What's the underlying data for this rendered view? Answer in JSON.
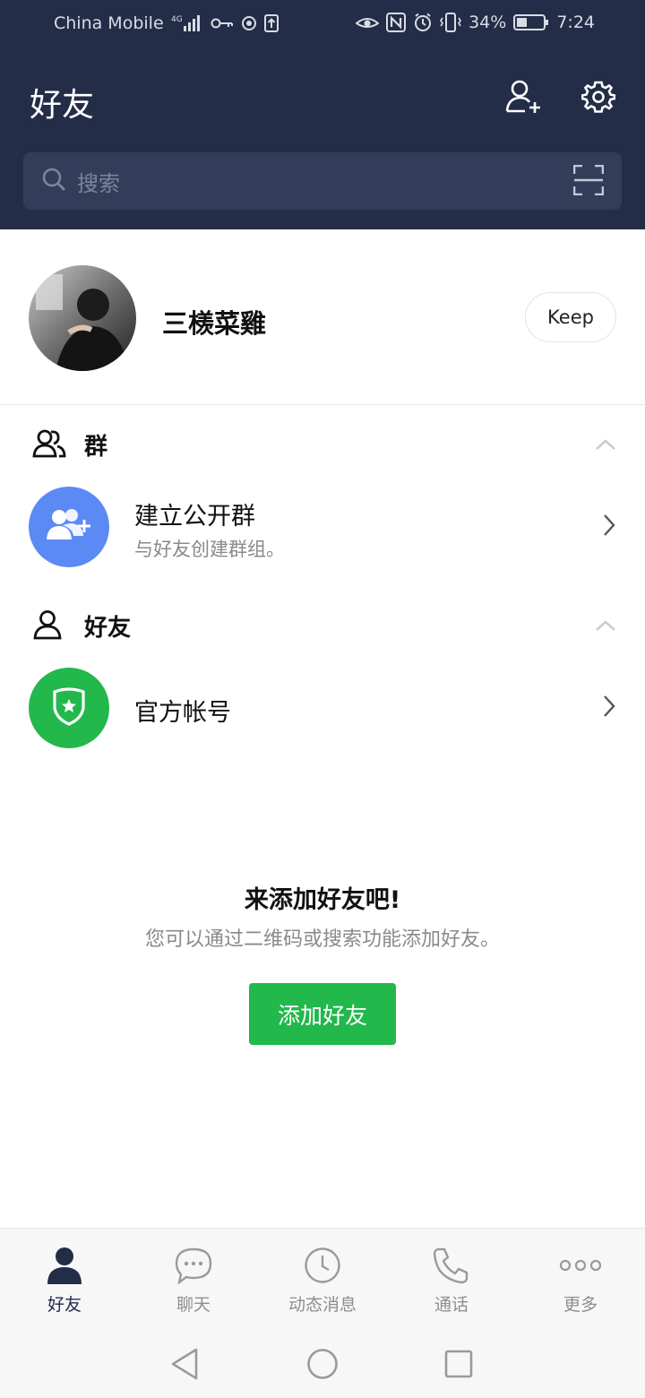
{
  "status_bar": {
    "carrier": "China Mobile",
    "network": "4G",
    "battery": "34%",
    "time": "7:24",
    "icons": [
      "signal-icon",
      "key-icon",
      "sync-icon",
      "upload-icon",
      "eye-icon",
      "nfc-icon",
      "alarm-icon",
      "vibrate-icon",
      "battery-icon"
    ]
  },
  "header": {
    "title": "好友",
    "add_friend_icon": "add-friend-icon",
    "settings_icon": "gear-icon"
  },
  "search": {
    "placeholder": "搜索"
  },
  "profile": {
    "name": "三檨菜雞",
    "keep_label": "Keep"
  },
  "groups": {
    "label": "群",
    "create_title": "建立公开群",
    "create_subtitle": "与好友创建群组。"
  },
  "friends": {
    "label": "好友",
    "official_title": "官方帐号"
  },
  "empty_state": {
    "title": "来添加好友吧!",
    "description": "您可以通过二维码或搜索功能添加好友。",
    "button_label": "添加好友"
  },
  "bottom_nav": {
    "items": [
      {
        "label": "好友",
        "icon": "person-icon",
        "active": true
      },
      {
        "label": "聊天",
        "icon": "chat-icon",
        "active": false
      },
      {
        "label": "动态消息",
        "icon": "clock-icon",
        "active": false
      },
      {
        "label": "通话",
        "icon": "phone-icon",
        "active": false
      },
      {
        "label": "更多",
        "icon": "more-icon",
        "active": false
      }
    ]
  },
  "colors": {
    "header_bg": "#232d48",
    "search_bg": "#333d5a",
    "accent_green": "#22b84c",
    "group_blue": "#5b8af5",
    "official_green": "#22b84c"
  }
}
